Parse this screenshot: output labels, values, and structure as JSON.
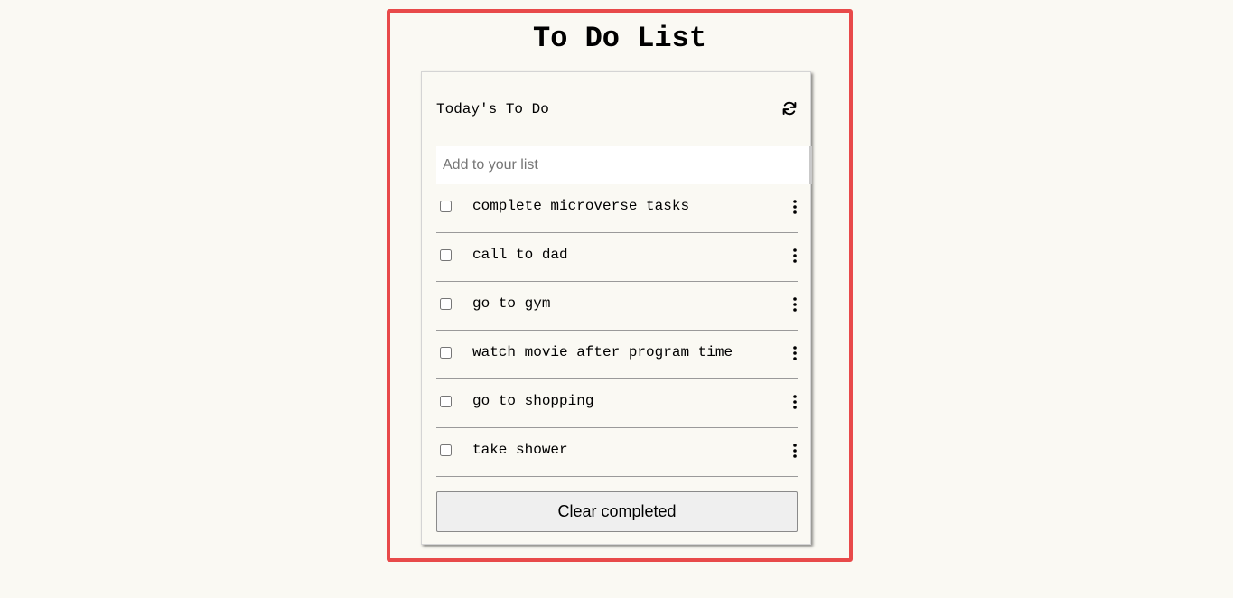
{
  "app": {
    "title": "To Do List"
  },
  "card": {
    "title": "Today's To Do",
    "refresh_icon": "refresh-icon"
  },
  "add_input": {
    "placeholder": "Add to your list",
    "value": ""
  },
  "todos": [
    {
      "text": "complete microverse tasks",
      "completed": false,
      "menu_icon": "more-vertical-icon"
    },
    {
      "text": "call to dad",
      "completed": false,
      "menu_icon": "more-vertical-icon"
    },
    {
      "text": "go to gym",
      "completed": false,
      "menu_icon": "more-vertical-icon"
    },
    {
      "text": "watch movie after program time",
      "completed": false,
      "menu_icon": "more-vertical-icon"
    },
    {
      "text": "go to shopping",
      "completed": false,
      "menu_icon": "more-vertical-icon"
    },
    {
      "text": "take shower",
      "completed": false,
      "menu_icon": "more-vertical-icon"
    }
  ],
  "clear_button": {
    "label": "Clear completed"
  },
  "colors": {
    "background": "#faf9f3",
    "frame_border": "#e84a4a",
    "divider": "#9a9a9a",
    "button_bg": "#efefef"
  }
}
